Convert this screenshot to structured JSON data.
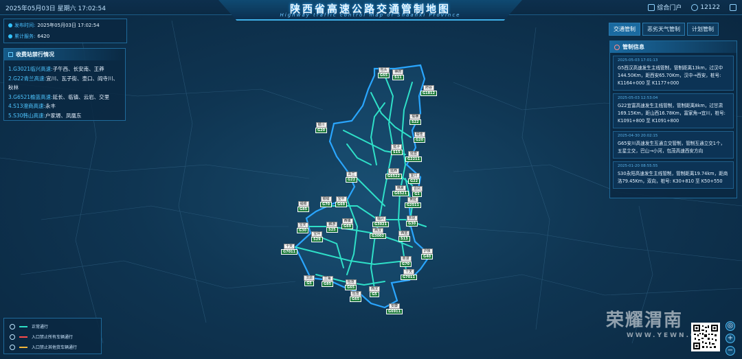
{
  "header": {
    "datetime": "2025年05月03日 星期六  17:02:54",
    "title": "陕西省高速公路交通管制地图",
    "subtitle": "Highway traffic control map of Shaanxi Province",
    "portal_label": "综合门户",
    "user_label": "12122"
  },
  "info": {
    "publish_key": "发布时间:",
    "publish_val": "2025年05月03日 17:02:54",
    "service_key": "累计服务:",
    "service_val": "6420"
  },
  "stations": {
    "title": "收费站禁行情况",
    "items": [
      {
        "road": "1.G3021临兴高速:",
        "stations": "子午西、长安南、王莽"
      },
      {
        "road": "2.G22青兰高速:",
        "stations": "宜川、瓦子街、壶口、阎寺川、秋林"
      },
      {
        "road": "3.G6521榆蓝高速:",
        "stations": "延长、临镇、云岩、交里"
      },
      {
        "road": "4.S13澄商高速:",
        "stations": "永丰"
      },
      {
        "road": "5.S30韩山高速:",
        "stations": "户家塬、凤凰东"
      }
    ]
  },
  "tabs": [
    {
      "label": "交通管制",
      "active": true
    },
    {
      "label": "恶劣天气管制",
      "active": false
    },
    {
      "label": "计划管制",
      "active": false
    }
  ],
  "notices": {
    "title": "管制信息",
    "items": [
      {
        "time": "2025-05-03 17:01:13",
        "text": "G5西汉高速发生主线管制，管制距离13km，过汉中144.50Km，距西安65.70Km，汉中→西安，桩号: K1164+000 至 K1177+000"
      },
      {
        "time": "2025-05-03 12:53:04",
        "text": "G22宜富高速发生主线管制，管制距离8km，过甘肃169.15Km，距山西16.78Km，富家角→宜川，桩号: K1091+800 至 K1091+800"
      },
      {
        "time": "2025-04-30 20:02:15",
        "text": "G65安川高速发生互通立交管制，管制互通立交1个，五星立交，巴山→小河，包茂高速西安方向"
      },
      {
        "time": "2025-01-20 08:55:55",
        "text": "S30永阳高速发生主线管制，管制距离19.74km，距商洛79.45Km，双向，桩号: K30+810 至 K50+550"
      }
    ]
  },
  "legend": [
    {
      "label": "正常通行",
      "color": "#2fe0c8"
    },
    {
      "label": "入口禁止所有车辆通行",
      "color": "#ff4b4b"
    },
    {
      "label": "入口禁止其他货车辆通行",
      "color": "#f4b63a"
    }
  ],
  "watermark": {
    "brand": "荣耀渭南",
    "url": "WWW.YEWN.CN"
  },
  "zoom": {
    "in": "+",
    "out": "−"
  },
  "signs": [
    {
      "name": "包头",
      "code": "G65"
    },
    {
      "name": "神府",
      "code": "S11"
    },
    {
      "name": "府谷",
      "code": "G1812"
    },
    {
      "name": "榆横",
      "code": "S22"
    },
    {
      "name": "银川",
      "code": "G20"
    },
    {
      "name": "榆佳",
      "code": "G20"
    },
    {
      "name": "延子",
      "code": "S15"
    },
    {
      "name": "延壶",
      "code": "G2211"
    },
    {
      "name": "延西",
      "code": "G6522"
    },
    {
      "name": "青兰",
      "code": "G22"
    },
    {
      "name": "宜川",
      "code": "G22"
    },
    {
      "name": "韩夏",
      "code": "G6521"
    },
    {
      "name": "合凤",
      "code": "G1"
    },
    {
      "name": "黄延",
      "code": "G2511"
    },
    {
      "name": "银榆",
      "code": "G70"
    },
    {
      "name": "宝平",
      "code": "G69"
    },
    {
      "name": "福银",
      "code": "G85"
    },
    {
      "name": "临兴",
      "code": "G3021"
    },
    {
      "name": "京昆",
      "code": "G30"
    },
    {
      "name": "宝天",
      "code": "G30"
    },
    {
      "name": "麟游",
      "code": "S25"
    },
    {
      "name": "西汉",
      "code": "G3002"
    },
    {
      "name": "西蓝",
      "code": "S13"
    },
    {
      "name": "宝坪",
      "code": "S29"
    },
    {
      "name": "十天",
      "code": "G7011"
    },
    {
      "name": "沪陕",
      "code": "G40"
    },
    {
      "name": "商漫",
      "code": "G70"
    },
    {
      "name": "十天",
      "code": "G7011"
    },
    {
      "name": "汉渝",
      "code": "G5"
    },
    {
      "name": "兰海",
      "code": "G85"
    },
    {
      "name": "包茂",
      "code": "G65"
    },
    {
      "name": "西汉",
      "code": "G5"
    },
    {
      "name": "包茂",
      "code": "G65"
    },
    {
      "name": "安康",
      "code": "G6911"
    },
    {
      "name": "西镇",
      "code": "G69"
    }
  ]
}
